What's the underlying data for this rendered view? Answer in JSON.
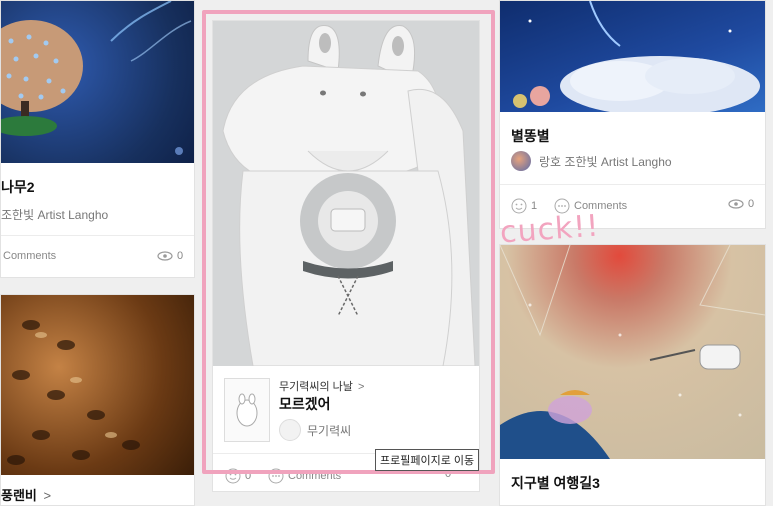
{
  "cards": {
    "left_top": {
      "title": "나무2",
      "author": "조한빛 Artist Langho",
      "comments_label": "Comments",
      "views": "0"
    },
    "left_bottom": {
      "title": "풍랜비",
      "chevron": ">"
    },
    "center": {
      "series": "무기력씨의 나날",
      "chevron": ">",
      "title": "모르겠어",
      "author": "무기력씨",
      "likes": "0",
      "comments_label": "Comments",
      "views": "0"
    },
    "right_top": {
      "title": "별똥별",
      "author": "랑호 조한빛 Artist Langho",
      "likes": "1",
      "comments_label": "Comments",
      "views": "0"
    },
    "right_bottom": {
      "title": "지구별 여행길3"
    }
  },
  "tooltip": "프로필페이지로 이동",
  "annotation": "cuck!!",
  "colors": {
    "highlight": "#f0a3bd",
    "night_sky": "#1e3a78",
    "card_bg": "#ffffff"
  }
}
